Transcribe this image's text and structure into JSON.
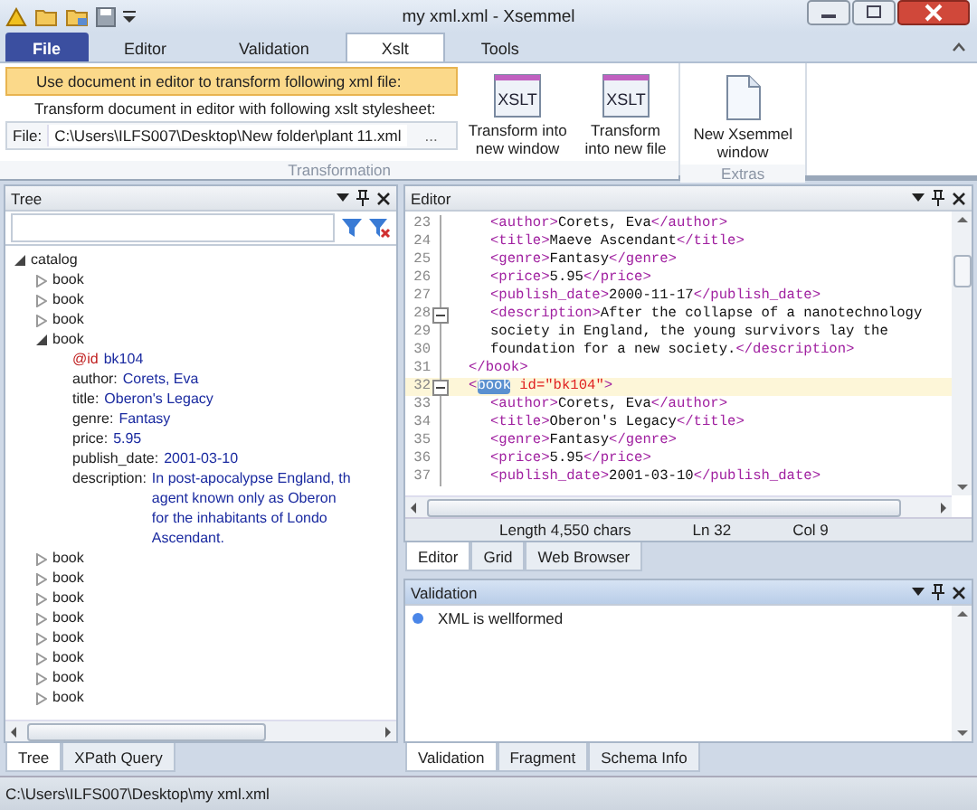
{
  "window": {
    "title": "my xml.xml - Xsemmel"
  },
  "ribbon_tabs": [
    {
      "label": "File",
      "kind": "file",
      "selected": false
    },
    {
      "label": "Editor",
      "kind": "tab",
      "selected": false
    },
    {
      "label": "Validation",
      "kind": "tab",
      "selected": false
    },
    {
      "label": "Xslt",
      "kind": "tab",
      "selected": true
    },
    {
      "label": "Tools",
      "kind": "tab",
      "selected": false
    }
  ],
  "transformation": {
    "source_option": {
      "label": "Use document in editor to transform following xml file:",
      "selected": true
    },
    "stylesheet_label": "Transform document in editor with following xslt stylesheet:",
    "file_label": "File:",
    "file_value": "C:\\Users\\ILFS007\\Desktop\\New folder\\plant 11.xml",
    "browse": "...",
    "buttons": [
      {
        "icon_text": "XSLT",
        "lines": [
          "Transform into",
          "new window"
        ]
      },
      {
        "icon_text": "XSLT",
        "lines": [
          "Transform",
          "into new file"
        ]
      }
    ],
    "group_label": "Transformation"
  },
  "extras": {
    "buttons": [
      {
        "lines": [
          "New Xsemmel",
          "window"
        ]
      }
    ],
    "group_label": "Extras"
  },
  "tree_pane": {
    "title": "Tree",
    "tree": [
      {
        "label": "catalog",
        "expanded": true,
        "children": [
          {
            "label": "book",
            "expanded": false
          },
          {
            "label": "book",
            "expanded": false
          },
          {
            "label": "book",
            "expanded": false
          },
          {
            "label": "book",
            "expanded": true,
            "children": [
              {
                "kind": "attribute",
                "name": "@id",
                "lines": [
                  "bk104"
                ]
              },
              {
                "kind": "element",
                "name": "author:",
                "lines": [
                  "Corets, Eva"
                ]
              },
              {
                "kind": "element",
                "name": "title:",
                "lines": [
                  "Oberon's Legacy"
                ]
              },
              {
                "kind": "element",
                "name": "genre:",
                "lines": [
                  "Fantasy"
                ]
              },
              {
                "kind": "element",
                "name": "price:",
                "lines": [
                  "5.95"
                ]
              },
              {
                "kind": "element",
                "name": "publish_date:",
                "lines": [
                  "2001-03-10"
                ]
              },
              {
                "kind": "element",
                "name": "description:",
                "lines": [
                  "In post-apocalypse England, th",
                  "agent known only as Oberon",
                  "for the inhabitants of Londo",
                  "Ascendant."
                ]
              }
            ]
          },
          {
            "label": "book",
            "expanded": false
          },
          {
            "label": "book",
            "expanded": false
          },
          {
            "label": "book",
            "expanded": false
          },
          {
            "label": "book",
            "expanded": false
          },
          {
            "label": "book",
            "expanded": false
          },
          {
            "label": "book",
            "expanded": false
          },
          {
            "label": "book",
            "expanded": false
          },
          {
            "label": "book",
            "expanded": false
          }
        ]
      }
    ],
    "tabs": [
      {
        "label": "Tree",
        "selected": true
      },
      {
        "label": "XPath Query",
        "selected": false
      }
    ]
  },
  "editor_pane": {
    "title": "Editor",
    "lines": [
      {
        "num": "23",
        "nested": true,
        "fold_start": false,
        "current": false,
        "tokens": [
          {
            "kind": "tag",
            "text": "<author>"
          },
          {
            "kind": "text",
            "text": "Corets, Eva"
          },
          {
            "kind": "tag",
            "text": "</author>"
          }
        ]
      },
      {
        "num": "24",
        "nested": true,
        "fold_start": false,
        "current": false,
        "tokens": [
          {
            "kind": "tag",
            "text": "<title>"
          },
          {
            "kind": "text",
            "text": "Maeve Ascendant"
          },
          {
            "kind": "tag",
            "text": "</title>"
          }
        ]
      },
      {
        "num": "25",
        "nested": true,
        "fold_start": false,
        "current": false,
        "tokens": [
          {
            "kind": "tag",
            "text": "<genre>"
          },
          {
            "kind": "text",
            "text": "Fantasy"
          },
          {
            "kind": "tag",
            "text": "</genre>"
          }
        ]
      },
      {
        "num": "26",
        "nested": true,
        "fold_start": false,
        "current": false,
        "tokens": [
          {
            "kind": "tag",
            "text": "<price>"
          },
          {
            "kind": "text",
            "text": "5.95"
          },
          {
            "kind": "tag",
            "text": "</price>"
          }
        ]
      },
      {
        "num": "27",
        "nested": true,
        "fold_start": false,
        "current": false,
        "tokens": [
          {
            "kind": "tag",
            "text": "<publish_date>"
          },
          {
            "kind": "text",
            "text": "2000-11-17"
          },
          {
            "kind": "tag",
            "text": "</publish_date>"
          }
        ]
      },
      {
        "num": "28",
        "nested": true,
        "fold_start": true,
        "current": false,
        "tokens": [
          {
            "kind": "tag",
            "text": "<description>"
          },
          {
            "kind": "text",
            "text": "After the collapse of a nanotechnology"
          }
        ]
      },
      {
        "num": "29",
        "nested": true,
        "fold_start": false,
        "current": false,
        "tokens": [
          {
            "kind": "text",
            "text": "society in England, the young survivors lay the"
          }
        ]
      },
      {
        "num": "30",
        "nested": true,
        "fold_start": false,
        "current": false,
        "tokens": [
          {
            "kind": "text",
            "text": "foundation for a new society."
          },
          {
            "kind": "tag",
            "text": "</description>"
          }
        ]
      },
      {
        "num": "31",
        "nested": false,
        "fold_start": false,
        "current": false,
        "tokens": [
          {
            "kind": "tag",
            "text": "</book>"
          }
        ]
      },
      {
        "num": "32",
        "nested": false,
        "fold_start": true,
        "current": true,
        "tokens": [
          {
            "kind": "tag",
            "text": "<"
          },
          {
            "kind": "selected",
            "text": "book"
          },
          {
            "kind": "attr",
            "text": " id=\"bk104\""
          },
          {
            "kind": "tag",
            "text": ">"
          }
        ]
      },
      {
        "num": "33",
        "nested": true,
        "fold_start": false,
        "current": false,
        "tokens": [
          {
            "kind": "tag",
            "text": "<author>"
          },
          {
            "kind": "text",
            "text": "Corets, Eva"
          },
          {
            "kind": "tag",
            "text": "</author>"
          }
        ]
      },
      {
        "num": "34",
        "nested": true,
        "fold_start": false,
        "current": false,
        "tokens": [
          {
            "kind": "tag",
            "text": "<title>"
          },
          {
            "kind": "text",
            "text": "Oberon's Legacy"
          },
          {
            "kind": "tag",
            "text": "</title>"
          }
        ]
      },
      {
        "num": "35",
        "nested": true,
        "fold_start": false,
        "current": false,
        "tokens": [
          {
            "kind": "tag",
            "text": "<genre>"
          },
          {
            "kind": "text",
            "text": "Fantasy"
          },
          {
            "kind": "tag",
            "text": "</genre>"
          }
        ]
      },
      {
        "num": "36",
        "nested": true,
        "fold_start": false,
        "current": false,
        "tokens": [
          {
            "kind": "tag",
            "text": "<price>"
          },
          {
            "kind": "text",
            "text": "5.95"
          },
          {
            "kind": "tag",
            "text": "</price>"
          }
        ]
      },
      {
        "num": "37",
        "nested": true,
        "fold_start": false,
        "current": false,
        "tokens": [
          {
            "kind": "tag",
            "text": "<publish_date>"
          },
          {
            "kind": "text",
            "text": "2001-03-10"
          },
          {
            "kind": "tag",
            "text": "</publish_date>"
          }
        ]
      }
    ],
    "status": [
      "Length 4,550 chars",
      "Ln 32",
      "Col 9"
    ],
    "tabs": [
      {
        "label": "Editor",
        "selected": true
      },
      {
        "label": "Grid",
        "selected": false
      },
      {
        "label": "Web Browser",
        "selected": false
      }
    ]
  },
  "validation_pane": {
    "title": "Validation",
    "messages": [
      {
        "text": "XML is wellformed",
        "color": "#4a86e8"
      }
    ],
    "tabs": [
      {
        "label": "Validation",
        "selected": true
      },
      {
        "label": "Fragment",
        "selected": false
      },
      {
        "label": "Schema Info",
        "selected": false
      }
    ]
  },
  "status_bar": "C:\\Users\\ILFS007\\Desktop\\my xml.xml"
}
